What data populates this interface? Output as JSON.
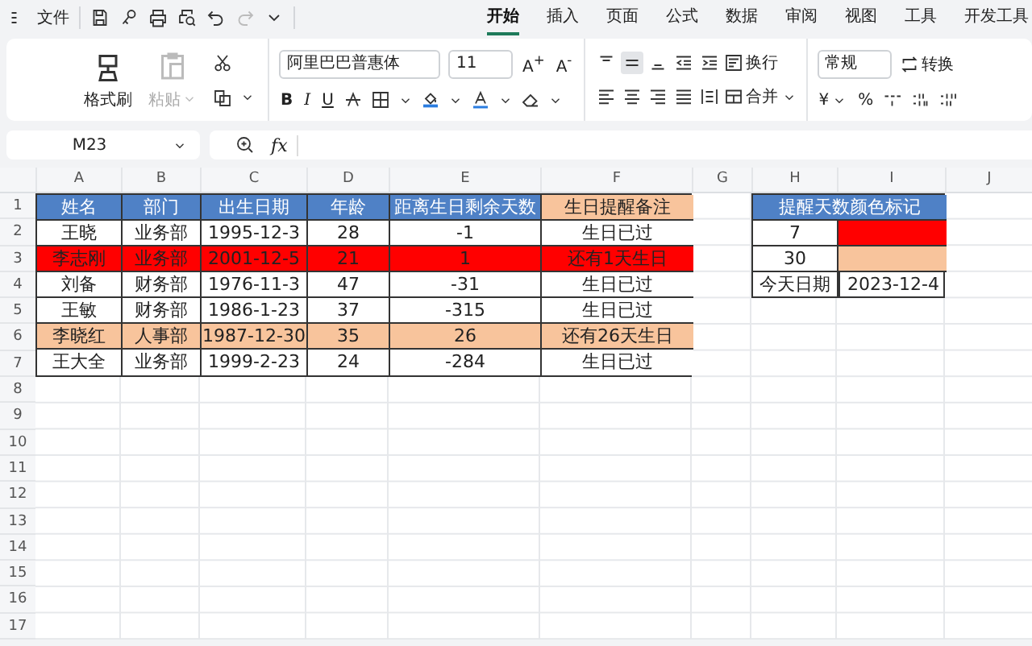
{
  "menu": {
    "file_label": "文件",
    "tabs": [
      {
        "label": "开始",
        "selected": true
      },
      {
        "label": "插入",
        "selected": false
      },
      {
        "label": "页面",
        "selected": false
      },
      {
        "label": "公式",
        "selected": false
      },
      {
        "label": "数据",
        "selected": false
      },
      {
        "label": "审阅",
        "selected": false
      },
      {
        "label": "视图",
        "selected": false
      },
      {
        "label": "工具",
        "selected": false
      },
      {
        "label": "开发工具",
        "selected": false
      }
    ]
  },
  "ribbon": {
    "format_painter": "格式刷",
    "paste": {
      "label": "粘贴",
      "disabled": true
    },
    "font_name": "阿里巴巴普惠体",
    "font_size": "11",
    "grow": "A$^{+}$",
    "shrink": "A$^{-}$",
    "style_buttons": [
      {
        "kind": "bold",
        "label": "B"
      },
      {
        "kind": "italic",
        "label": "I"
      },
      {
        "kind": "underline",
        "label": "U"
      }
    ],
    "align_top": [
      {
        "kind": "top",
        "selected": false
      },
      {
        "kind": "middle",
        "selected": true
      },
      {
        "kind": "bottom",
        "selected": false
      },
      {
        "kind": "outdent",
        "selected": false
      },
      {
        "kind": "indent",
        "selected": false
      }
    ],
    "align_bottom": [
      {
        "kind": "left",
        "selected": false
      },
      {
        "kind": "center",
        "selected": false
      },
      {
        "kind": "right",
        "selected": false
      },
      {
        "kind": "justify",
        "selected": false
      },
      {
        "kind": "distributed",
        "selected": false
      }
    ],
    "wrap": "换行",
    "merge": "合并",
    "number_format": "常规",
    "convert": "转换",
    "currency": "¥",
    "percent": "%"
  },
  "formula_bar": {
    "cell_ref": "M23",
    "fx": "fx"
  },
  "sheet": {
    "columns": [
      "A",
      "B",
      "C",
      "D",
      "E",
      "F",
      "G",
      "H",
      "I",
      "J"
    ],
    "row_numbers": [
      "1",
      "2",
      "3",
      "4",
      "5",
      "6",
      "7",
      "8",
      "9",
      "10",
      "11",
      "12",
      "13",
      "14",
      "15",
      "16",
      "17"
    ],
    "table": {
      "header": [
        {
          "text": "姓名",
          "color": "#4f81c6"
        },
        {
          "text": "部门",
          "color": "#4f81c6"
        },
        {
          "text": "出生日期",
          "color": "#4f81c6"
        },
        {
          "text": "年龄",
          "color": "#4f81c6"
        },
        {
          "text": "距离生日剩余天数",
          "color": "#4f81c6"
        },
        {
          "text": "生日提醒备注",
          "color": "#f8c49c"
        }
      ],
      "rows": [
        {
          "color": "#ffffff",
          "cells": [
            "王晓",
            "业务部",
            "1995-12-3",
            "28",
            "-1",
            "生日已过"
          ]
        },
        {
          "color": "#ff0000",
          "cells": [
            "李志刚",
            "业务部",
            "2001-12-5",
            "21",
            "1",
            "还有1天生日"
          ]
        },
        {
          "color": "#ffffff",
          "cells": [
            "刘备",
            "财务部",
            "1976-11-3",
            "47",
            "-31",
            "生日已过"
          ]
        },
        {
          "color": "#ffffff",
          "cells": [
            "王敏",
            "财务部",
            "1986-1-23",
            "37",
            "-315",
            "生日已过"
          ]
        },
        {
          "color": "#f8c49c",
          "cells": [
            "李晓红",
            "人事部",
            "1987-12-30",
            "35",
            "26",
            "还有26天生日"
          ]
        },
        {
          "color": "#ffffff",
          "cells": [
            "王大全",
            "业务部",
            "1999-2-23",
            "24",
            "-284",
            "生日已过"
          ]
        }
      ]
    },
    "legend": {
      "title": "提醒天数颜色标记",
      "rows": [
        {
          "label": "7",
          "color": "#ff0000"
        },
        {
          "label": "30",
          "color": "#f8c49c"
        }
      ],
      "today": {
        "label": "今天日期",
        "value": "2023-12-4"
      }
    }
  }
}
